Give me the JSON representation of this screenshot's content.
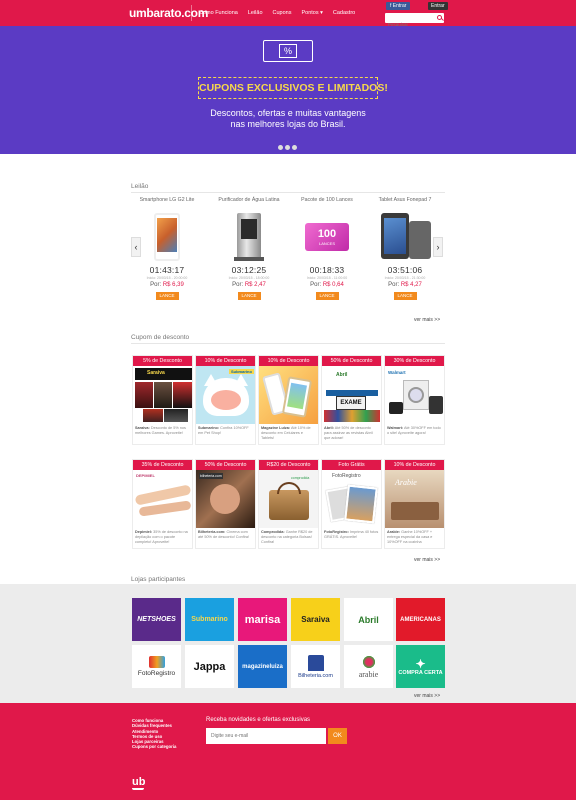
{
  "header": {
    "logo": "umbarato.com",
    "nav": [
      "Como Funciona",
      "Leilão",
      "Cupons",
      "Pontos ▾",
      "Cadastro"
    ],
    "fb_login": "f Entrar",
    "login": "Entrar",
    "search_placeholder": "Pesquisar"
  },
  "hero": {
    "icon_symbol": "%",
    "badge": "CUPONS EXCLUSIVOS E LIMITADOS!",
    "subtitle_line1": "Descontos, ofertas e muitas vantagens",
    "subtitle_line2": "nas melhores lojas do Brasil."
  },
  "auctions": {
    "title": "Leilão",
    "more": "ver mais >>",
    "items": [
      {
        "name": "Smartphone LG G2 Lite",
        "timer": "01:43:17",
        "start": "Início: 20/03/15 - 20:00:00",
        "price_label": "Por:",
        "price": "R$ 6,39",
        "button": "LANCE"
      },
      {
        "name": "Purificador de Água Latina",
        "timer": "03:12:25",
        "start": "Início: 20/03/15 - 18:00:00",
        "price_label": "Por:",
        "price": "R$ 2,47",
        "button": "LANCE"
      },
      {
        "name": "Pacote de 100 Lances",
        "timer": "00:18:33",
        "start": "Início: 20/03/15 - 11:00:00",
        "price_label": "Por:",
        "price": "R$ 0,64",
        "button": "LANCE",
        "product_text": "100",
        "product_subtext": "LANCES"
      },
      {
        "name": "Tablet Asus Fonepad 7",
        "timer": "03:51:06",
        "start": "Início: 20/03/15 - 21:30:00",
        "price_label": "Por:",
        "price": "R$ 4,27",
        "button": "LANCE"
      }
    ]
  },
  "coupons": {
    "title": "Cupom de desconto",
    "more": "ver mais >>",
    "items": [
      {
        "header": "5% de Desconto",
        "store": "Saraiva:",
        "desc": "Desconto de 5% nos melhores Games. Aproveite!",
        "brand": "Saraiva"
      },
      {
        "header": "10% de Desconto",
        "store": "Submarino:",
        "desc": "Confira 10%OFF em Pet Shop!",
        "brand": "Submarino"
      },
      {
        "header": "10% de Desconto",
        "store": "Magazine Luiza:",
        "desc": "Até 10% de desconto em Celulares e Tablets!",
        "brand": ""
      },
      {
        "header": "50% de Desconto",
        "store": "Abril:",
        "desc": "Até 50% de desconto para assinar as revistas Abril que adorar!",
        "brand": "Abril",
        "magazine": "EXAME"
      },
      {
        "header": "30% de Desconto",
        "store": "Walmart:",
        "desc": "Até 30%OFF em todo o site! Aproveite agora!",
        "brand": "Walmart"
      },
      {
        "header": "35% de Desconto",
        "store": "Depimiel:",
        "desc": "35% de desconto na depilação com o pacote completo! Aproveite!",
        "brand": "DEPIMIEL"
      },
      {
        "header": "50% de Desconto",
        "store": "Bilheteria.com:",
        "desc": "Cinema com até 50% de desconto! Confira!",
        "brand": "bilheteria.com"
      },
      {
        "header": "R$20 de Desconto",
        "store": "Comprodida:",
        "desc": "Ganhe R$20 de desconto na categoria Bolsas! Confira!",
        "brand": "comprodida"
      },
      {
        "header": "Foto Grátis",
        "store": "FotoRegistro:",
        "desc": "Imprima 40 fotos GRÁTIS. Aproveite!",
        "brand": "FotoRegistro"
      },
      {
        "header": "10% de Desconto",
        "store": "Arabie:",
        "desc": "Ganhe 10%OFF + entrega especial da casa e 10%OFF na cozinha",
        "brand": "Arabie"
      }
    ]
  },
  "stores": {
    "title": "Lojas participantes",
    "more": "ver mais >>",
    "items": [
      "NETSHOES",
      "Submarino",
      "marisa",
      "Saraiva",
      "Abril",
      "AMERICANAS",
      "FotoRegistro",
      "Jappa",
      "magazineluiza",
      "Bilheteria.com",
      "arabie",
      "COMPRA CERTA"
    ]
  },
  "footer": {
    "links": [
      "Como funciona",
      "Dúvidas frequentes",
      "Atendimento",
      "Termos de uso",
      "Lojas parceiras",
      "Cupons por categoria"
    ],
    "newsletter_title": "Receba novidades e ofertas exclusivas",
    "email_placeholder": "Digite seu e-mail",
    "ok": "OK",
    "logo": "ub"
  }
}
